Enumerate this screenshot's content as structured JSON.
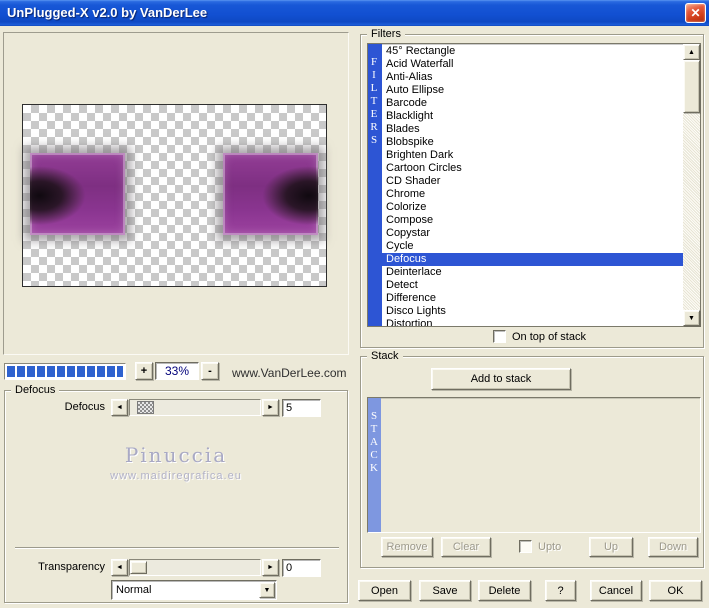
{
  "window": {
    "title": "UnPlugged-X v2.0 by VanDerLee"
  },
  "glyphs": {
    "close": "✕",
    "left": "◄",
    "right": "►",
    "up": "▲",
    "down": "▼"
  },
  "preview": {
    "zoom_in_label": "+",
    "zoom_level": "33%",
    "zoom_out_label": "-",
    "website": "www.VanDerLee.com"
  },
  "watermark": {
    "title": "Pinuccia",
    "url": "www.maidiregrafica.eu"
  },
  "defocus_group": {
    "legend": "Defocus",
    "slider_label": "Defocus",
    "value": "5"
  },
  "transparency": {
    "label": "Transparency",
    "value": "0",
    "blend_mode": "Normal"
  },
  "filters_group": {
    "legend": "Filters",
    "vertical_label": "FILTERS",
    "selected_item": "Defocus",
    "on_top_label": "On top of stack",
    "items": [
      "45° Rectangle",
      "Acid Waterfall",
      "Anti-Alias",
      "Auto Ellipse",
      "Barcode",
      "Blacklight",
      "Blades",
      "Blobspike",
      "Brighten Dark",
      "Cartoon Circles",
      "CD Shader",
      "Chrome",
      "Colorize",
      "Compose",
      "Copystar",
      "Cycle",
      "Defocus",
      "Deinterlace",
      "Detect",
      "Difference",
      "Disco Lights",
      "Distortion"
    ]
  },
  "stack_group": {
    "legend": "Stack",
    "add_button": "Add to stack",
    "vertical_label": "STACK",
    "remove_button": "Remove",
    "clear_button": "Clear",
    "upto_label": "Upto",
    "up_button": "Up",
    "down_button": "Down"
  },
  "footer": {
    "open": "Open",
    "save": "Save",
    "delete": "Delete",
    "help": "?",
    "cancel": "Cancel",
    "ok": "OK"
  },
  "colors": {
    "selection": "#2d55d4",
    "filters-strip": "#2d55d4",
    "stack-strip": "#7e97e0",
    "progress": "#2e62cf",
    "zoom-text": "#00007a",
    "watermark": "#a9a9c4"
  }
}
